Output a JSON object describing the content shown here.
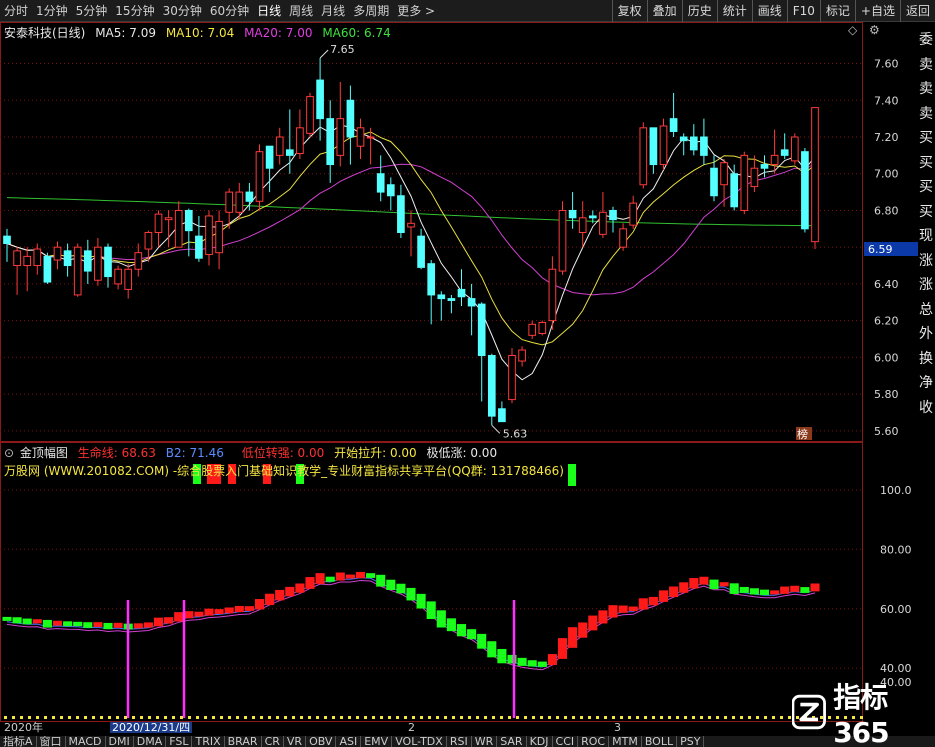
{
  "toolbar": {
    "periods": [
      "分时",
      "1分钟",
      "5分钟",
      "15分钟",
      "30分钟",
      "60分钟",
      "日线",
      "周线",
      "月线",
      "多周期",
      "更多 >"
    ],
    "active_period": "日线",
    "buttons": [
      "复权",
      "叠加",
      "历史",
      "统计",
      "画线",
      "F10",
      "标记",
      "+自选",
      "返回"
    ]
  },
  "main": {
    "stock": "安泰科技(日线)",
    "ma5": "MA5: 7.09",
    "ma10": "MA10: 7.04",
    "ma20": "MA20: 7.00",
    "ma60": "MA60: 6.74",
    "high_label": "7.65",
    "low_label": "5.63",
    "current_price": "6.59",
    "badge": "榜",
    "price_axis": [
      "7.60",
      "7.40",
      "7.20",
      "7.00",
      "6.80",
      "6.60",
      "6.40",
      "6.20",
      "6.00",
      "5.80",
      "5.60"
    ],
    "right_strip": [
      "委",
      "卖",
      "卖",
      "卖",
      "买",
      "买",
      "买",
      "买",
      "现",
      "涨",
      "涨",
      "总",
      "外",
      "换",
      "净",
      "收"
    ]
  },
  "indicator": {
    "name": "金顶幅图",
    "shengming": "生命线: 68.63",
    "b2": "B2: 71.46",
    "diwei": "低位转强: 0.00",
    "kaishi": "开始拉升: 0.00",
    "jidizhang": "极低涨: 0.00",
    "watermark": "万股网 (WWW.201082.COM) -综合股票入门基础知识教学_专业财富指标共享平台(QQ群: 131788466)",
    "axis": [
      "100.0",
      "80.00",
      "60.00",
      "40.00",
      "40.00"
    ],
    "right_digits": "14"
  },
  "dates": {
    "year": "2020年",
    "selected": "2020/12/31/四",
    "m2": "2",
    "m3": "3"
  },
  "bottom_tabs": [
    "指标A",
    "窗口",
    "MACD",
    "DMI",
    "DMA",
    "FSL",
    "TRIX",
    "BRAR",
    "CR",
    "VR",
    "OBV",
    "ASI",
    "EMV",
    "VOL-TDX",
    "RSI",
    "WR",
    "SAR",
    "KDJ",
    "CCI",
    "ROC",
    "MTM",
    "BOLL",
    "PSY"
  ],
  "logo": {
    "text": "指标365",
    "icon": "z-logo-icon"
  },
  "chart_data": {
    "type": "candlestick",
    "title": "安泰科技(日线)",
    "ylim": [
      5.55,
      7.75
    ],
    "yticks": [
      7.6,
      7.4,
      7.2,
      7.0,
      6.8,
      6.6,
      6.4,
      6.2,
      6.0,
      5.8,
      5.6
    ],
    "candles": [
      [
        6.66,
        6.62,
        6.52,
        6.7
      ],
      [
        6.5,
        6.58,
        6.34,
        6.6
      ],
      [
        6.5,
        6.55,
        6.36,
        6.6
      ],
      [
        6.5,
        6.59,
        6.45,
        6.62
      ],
      [
        6.55,
        6.41,
        6.4,
        6.57
      ],
      [
        6.53,
        6.6,
        6.48,
        6.63
      ],
      [
        6.58,
        6.5,
        6.44,
        6.62
      ],
      [
        6.34,
        6.6,
        6.33,
        6.62
      ],
      [
        6.58,
        6.47,
        6.4,
        6.64
      ],
      [
        6.42,
        6.6,
        6.39,
        6.65
      ],
      [
        6.6,
        6.44,
        6.38,
        6.62
      ],
      [
        6.4,
        6.48,
        6.37,
        6.5
      ],
      [
        6.37,
        6.48,
        6.32,
        6.51
      ],
      [
        6.48,
        6.57,
        6.44,
        6.62
      ],
      [
        6.59,
        6.68,
        6.52,
        6.69
      ],
      [
        6.68,
        6.78,
        6.6,
        6.8
      ],
      [
        6.75,
        6.76,
        6.6,
        6.8
      ],
      [
        6.6,
        6.8,
        6.6,
        6.85
      ],
      [
        6.8,
        6.69,
        6.55,
        6.81
      ],
      [
        6.66,
        6.54,
        6.52,
        6.77
      ],
      [
        6.56,
        6.77,
        6.5,
        6.8
      ],
      [
        6.57,
        6.74,
        6.48,
        6.8
      ],
      [
        6.79,
        6.9,
        6.7,
        6.92
      ],
      [
        6.79,
        6.9,
        6.75,
        6.95
      ],
      [
        6.9,
        6.85,
        6.8,
        6.95
      ],
      [
        6.85,
        7.12,
        6.8,
        7.16
      ],
      [
        7.15,
        7.03,
        6.9,
        7.15
      ],
      [
        7.1,
        7.2,
        7.05,
        7.25
      ],
      [
        7.13,
        7.1,
        7.0,
        7.35
      ],
      [
        7.11,
        7.25,
        7.08,
        7.35
      ],
      [
        7.22,
        7.42,
        7.2,
        7.44
      ],
      [
        7.51,
        7.3,
        7.18,
        7.63
      ],
      [
        7.3,
        7.05,
        6.95,
        7.4
      ],
      [
        7.1,
        7.3,
        7.04,
        7.5
      ],
      [
        7.4,
        7.2,
        7.05,
        7.48
      ],
      [
        7.15,
        7.25,
        7.08,
        7.3
      ],
      [
        7.2,
        7.2,
        7.05,
        7.25
      ],
      [
        7.0,
        6.9,
        6.85,
        7.1
      ],
      [
        6.94,
        6.88,
        6.8,
        6.98
      ],
      [
        6.88,
        6.68,
        6.65,
        6.94
      ],
      [
        6.71,
        6.73,
        6.55,
        6.8
      ],
      [
        6.66,
        6.49,
        6.48,
        6.7
      ],
      [
        6.51,
        6.34,
        6.18,
        6.53
      ],
      [
        6.34,
        6.32,
        6.2,
        6.36
      ],
      [
        6.32,
        6.31,
        6.24,
        6.34
      ],
      [
        6.37,
        6.33,
        6.28,
        6.48
      ],
      [
        6.32,
        6.28,
        6.12,
        6.4
      ],
      [
        6.29,
        6.01,
        5.76,
        6.3
      ],
      [
        6.01,
        5.68,
        5.63,
        6.02
      ],
      [
        5.72,
        5.65,
        5.65,
        5.76
      ],
      [
        5.77,
        6.01,
        5.75,
        6.05
      ],
      [
        5.98,
        6.04,
        5.95,
        6.06
      ],
      [
        6.12,
        6.18,
        6.1,
        6.2
      ],
      [
        6.13,
        6.19,
        6.12,
        6.2
      ],
      [
        6.2,
        6.48,
        6.15,
        6.55
      ],
      [
        6.47,
        6.8,
        6.45,
        6.85
      ],
      [
        6.8,
        6.76,
        6.7,
        6.9
      ],
      [
        6.68,
        6.76,
        6.6,
        6.85
      ],
      [
        6.77,
        6.76,
        6.73,
        6.8
      ],
      [
        6.67,
        6.79,
        6.65,
        6.9
      ],
      [
        6.8,
        6.75,
        6.68,
        6.82
      ],
      [
        6.6,
        6.7,
        6.58,
        6.73
      ],
      [
        6.72,
        6.84,
        6.7,
        6.88
      ],
      [
        6.94,
        7.25,
        6.92,
        7.28
      ],
      [
        7.25,
        7.05,
        7.0,
        7.25
      ],
      [
        7.05,
        7.26,
        7.02,
        7.3
      ],
      [
        7.3,
        7.23,
        7.2,
        7.44
      ],
      [
        7.2,
        7.18,
        7.1,
        7.22
      ],
      [
        7.2,
        7.13,
        7.1,
        7.27
      ],
      [
        7.2,
        7.1,
        7.05,
        7.3
      ],
      [
        7.03,
        6.88,
        6.85,
        7.1
      ],
      [
        6.94,
        7.06,
        6.82,
        7.08
      ],
      [
        7.0,
        6.82,
        6.8,
        7.05
      ],
      [
        6.8,
        7.1,
        6.78,
        7.12
      ],
      [
        6.93,
        7.03,
        6.9,
        7.1
      ],
      [
        7.05,
        7.03,
        6.98,
        7.1
      ],
      [
        7.05,
        7.1,
        7.0,
        7.24
      ],
      [
        7.13,
        7.1,
        7.08,
        7.22
      ],
      [
        7.07,
        7.2,
        7.05,
        7.22
      ],
      [
        7.12,
        6.7,
        6.68,
        7.14
      ],
      [
        6.63,
        7.36,
        6.59,
        7.36
      ]
    ]
  }
}
